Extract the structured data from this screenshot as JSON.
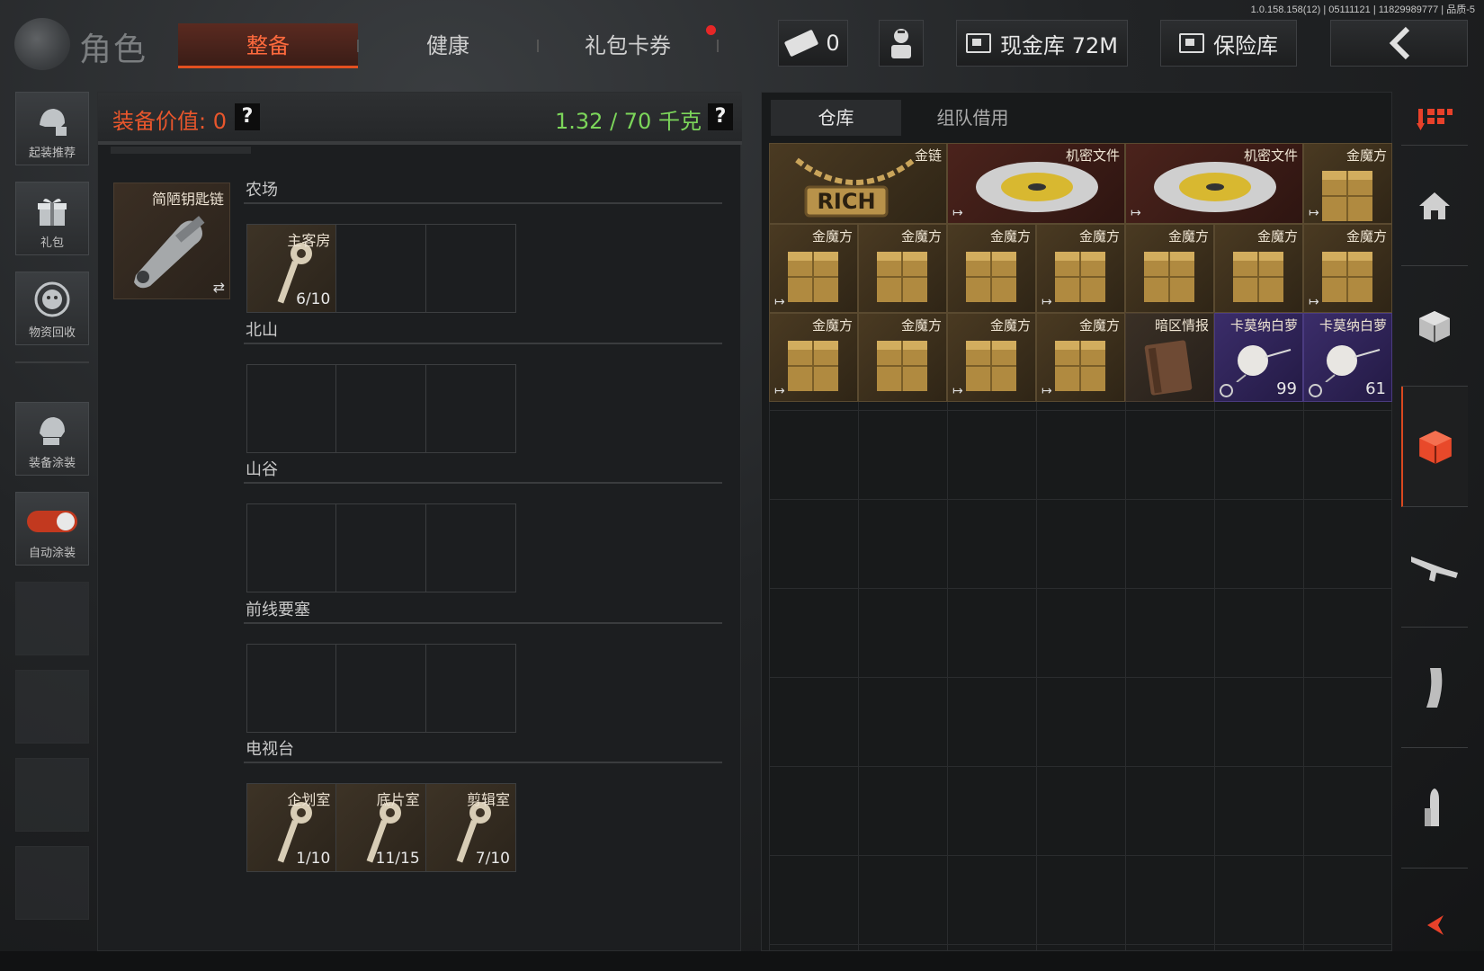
{
  "version": "1.0.158.158(12) | 05111121 | 11829989777 | 品质-5",
  "header": {
    "title": "角色",
    "tabs": [
      {
        "label": "整备",
        "active": true
      },
      {
        "label": "健康",
        "active": false
      },
      {
        "label": "礼包卡券",
        "active": false
      }
    ],
    "ticket_count": "0",
    "cash_vault": "现金库 72M",
    "safe_box": "保险库"
  },
  "left_sidebar": {
    "items": [
      {
        "label": "起装推荐",
        "icon": "helmet-icon"
      },
      {
        "label": "礼包",
        "icon": "gift-icon"
      },
      {
        "label": "物资回收",
        "icon": "recycle-icon"
      },
      {
        "label": "装备涂装",
        "icon": "paint-helmet-icon"
      },
      {
        "label": "自动涂装",
        "icon": "toggle-icon"
      }
    ]
  },
  "equipment": {
    "value_label": "装备价值: 0",
    "help": "?",
    "weight": "1.32 / 70 千克",
    "keychain": {
      "name": "简陋钥匙链",
      "swap": "⇄"
    },
    "locations": [
      {
        "name": "农场",
        "keys": [
          {
            "name": "主客房",
            "count": "6/10"
          }
        ]
      },
      {
        "name": "北山",
        "keys": []
      },
      {
        "name": "山谷",
        "keys": []
      },
      {
        "name": "前线要塞",
        "keys": []
      },
      {
        "name": "电视台",
        "keys": [
          {
            "name": "企划室",
            "count": "1/10"
          },
          {
            "name": "底片室",
            "count": "11/15"
          },
          {
            "name": "剪辑室",
            "count": "7/10"
          }
        ]
      }
    ]
  },
  "warehouse": {
    "tabs": [
      {
        "label": "仓库",
        "active": true
      },
      {
        "label": "组队借用",
        "active": false
      }
    ],
    "items": [
      {
        "name": "金链",
        "style": "gold"
      },
      {
        "name": "机密文件",
        "style": "red"
      },
      {
        "name": "机密文件",
        "style": "red"
      },
      {
        "name": "金魔方",
        "style": "gold"
      },
      {
        "name": "金魔方",
        "style": "gold"
      },
      {
        "name": "金魔方",
        "style": "gold"
      },
      {
        "name": "金魔方",
        "style": "gold"
      },
      {
        "name": "金魔方",
        "style": "gold"
      },
      {
        "name": "金魔方",
        "style": "gold"
      },
      {
        "name": "金魔方",
        "style": "gold"
      },
      {
        "name": "金魔方",
        "style": "gold"
      },
      {
        "name": "金魔方",
        "style": "gold"
      },
      {
        "name": "金魔方",
        "style": "gold"
      },
      {
        "name": "金魔方",
        "style": "gold"
      },
      {
        "name": "金魔方",
        "style": "gold"
      },
      {
        "name": "暗区情报",
        "style": "brown"
      },
      {
        "name": "卡莫纳白萝",
        "style": "purple",
        "count": "99"
      },
      {
        "name": "卡莫纳白萝",
        "style": "purple",
        "count": "61"
      }
    ]
  },
  "right_sidebar": {
    "items": [
      "sort-icon",
      "home-icon",
      "package-icon",
      "warehouse-cube-icon",
      "rifle-icon",
      "magazine-icon",
      "ammo-icon"
    ],
    "active": "warehouse-cube-icon"
  },
  "colors": {
    "accent": "#e35020",
    "weight_green": "#7cd65a",
    "value_orange": "#e8562c"
  }
}
